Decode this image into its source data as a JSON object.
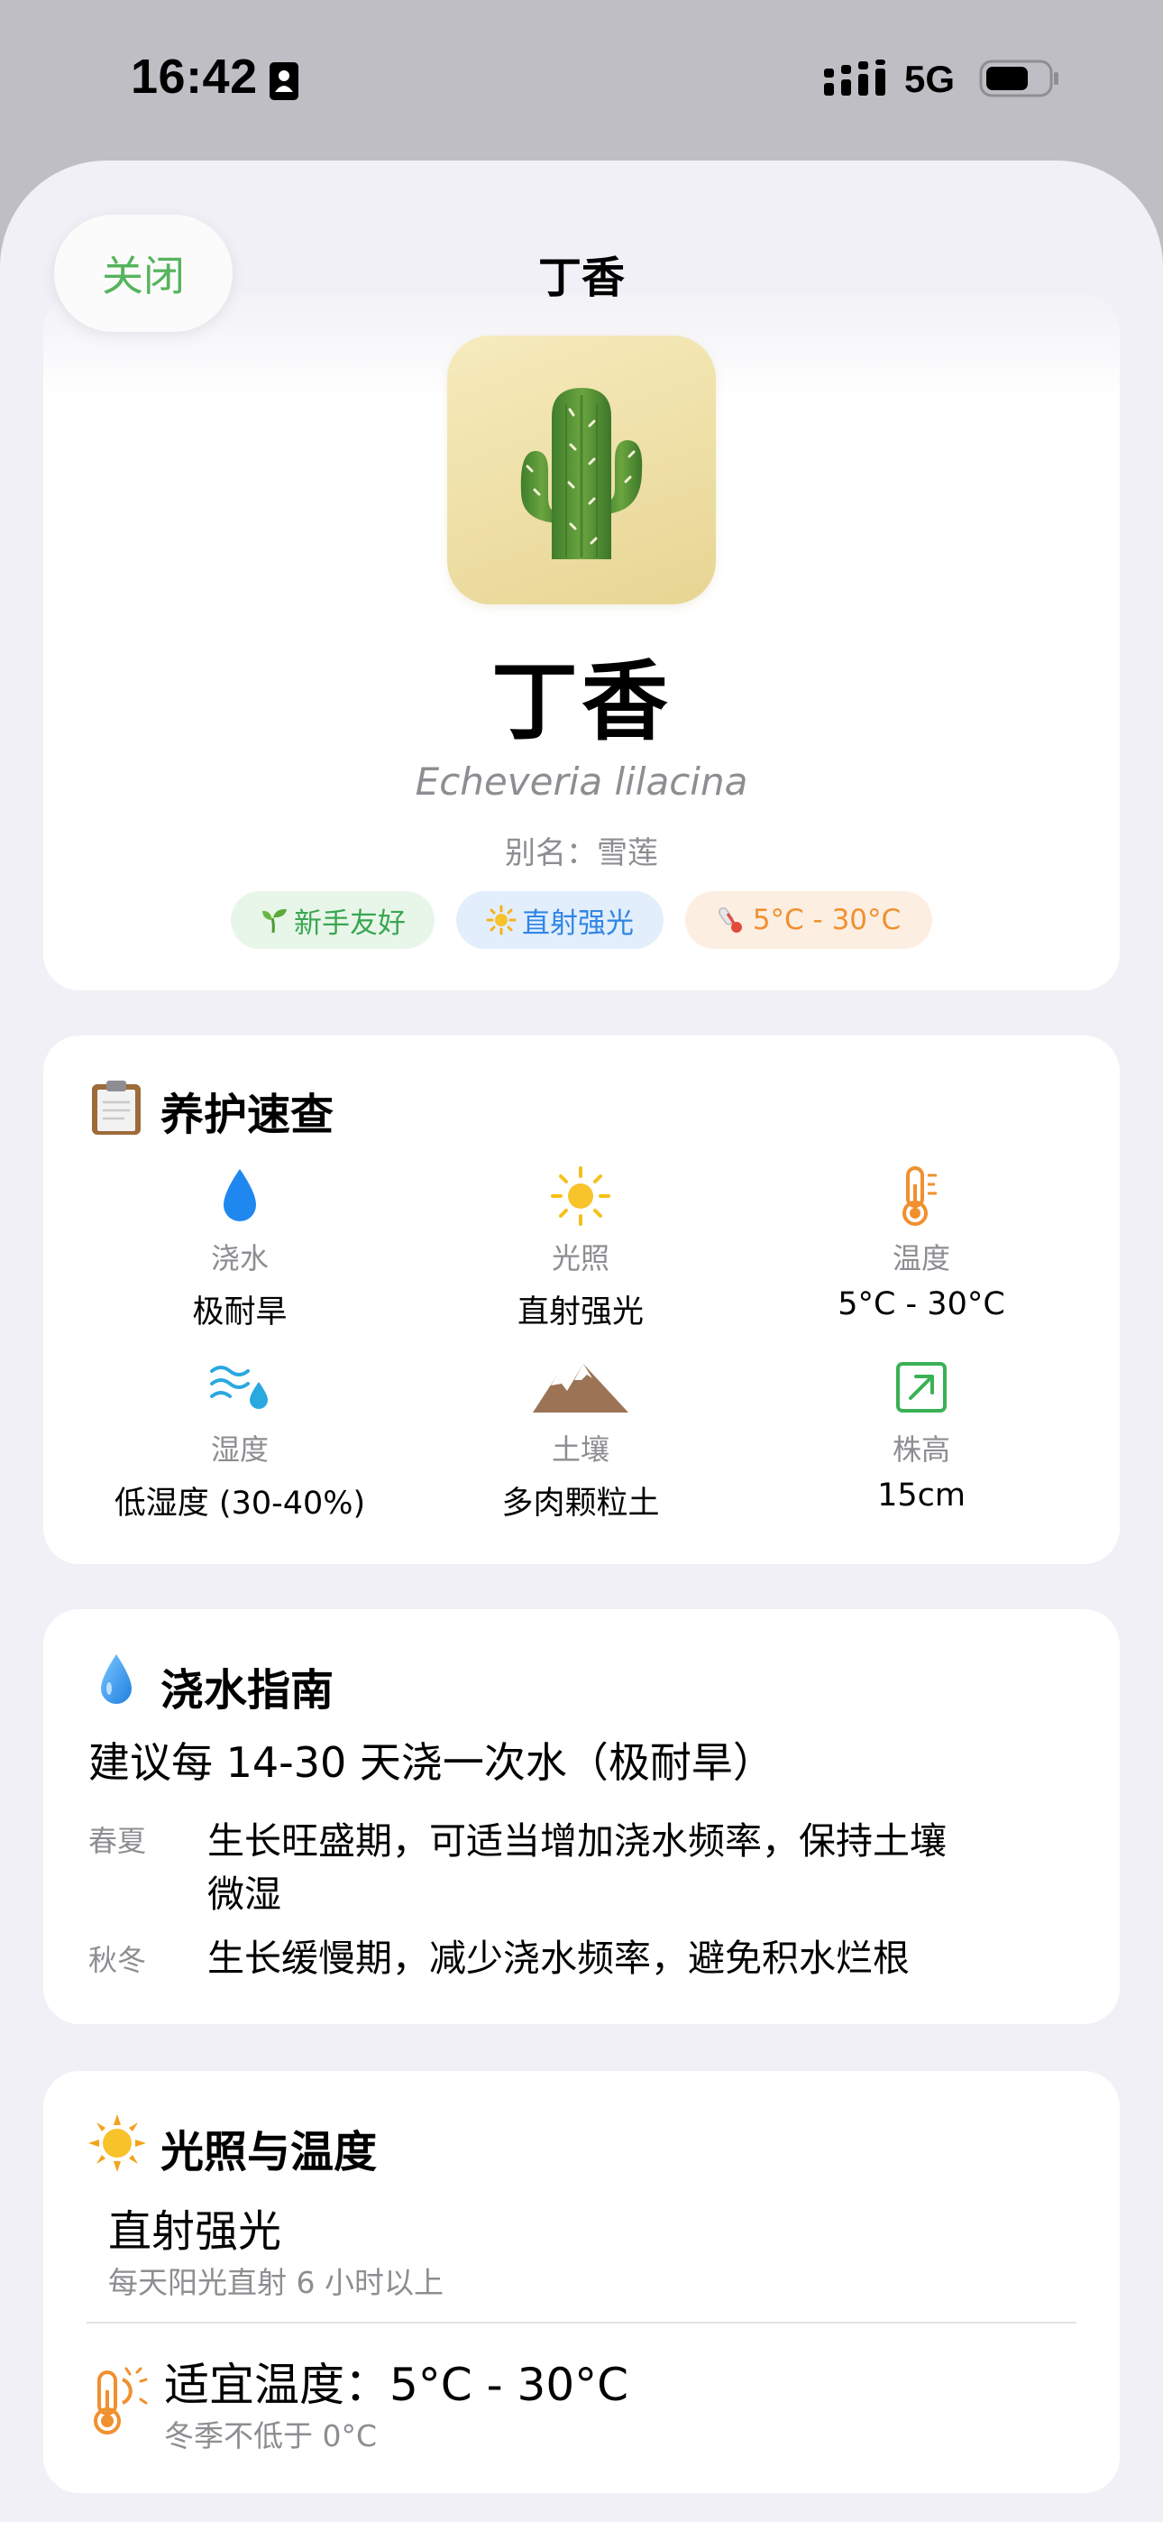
{
  "status_bar": {
    "time": "16:42",
    "network": "5G"
  },
  "header": {
    "close_label": "关闭",
    "title": "丁香"
  },
  "plant": {
    "icon": "cactus-icon",
    "name": "丁香",
    "latin_name": "Echeveria lilacina",
    "alias_text": "别名：雪莲",
    "tags": [
      {
        "icon": "seedling-icon",
        "label": "新手友好",
        "color": "#3aa650"
      },
      {
        "icon": "sun-icon",
        "label": "直射强光",
        "color": "#2f86e6"
      },
      {
        "icon": "thermometer-icon",
        "label": "5°C - 30°C",
        "color": "#f0902f"
      }
    ]
  },
  "care_quick": {
    "title": "养护速查",
    "icon": "clipboard-icon",
    "items": [
      {
        "icon": "water-drop-icon",
        "label": "浇水",
        "value": "极耐旱"
      },
      {
        "icon": "sun-icon",
        "label": "光照",
        "value": "直射强光"
      },
      {
        "icon": "thermometer-icon",
        "label": "温度",
        "value": "5°C - 30°C"
      },
      {
        "icon": "humidity-icon",
        "label": "湿度",
        "value": "低湿度 (30-40%)"
      },
      {
        "icon": "mountain-icon",
        "label": "土壤",
        "value": "多肉颗粒土"
      },
      {
        "icon": "height-arrow-icon",
        "label": "株高",
        "value": "15cm"
      }
    ]
  },
  "watering": {
    "title": "浇水指南",
    "icon": "water-drop-icon",
    "summary": "建议每 14-30 天浇一次水（极耐旱）",
    "seasons": [
      {
        "label": "春夏",
        "text": "生长旺盛期，可适当增加浇水频率，保持土壤微湿"
      },
      {
        "label": "秋冬",
        "text": "生长缓慢期，减少浇水频率，避免积水烂根"
      }
    ]
  },
  "light_temp": {
    "title": "光照与温度",
    "icon": "sun-icon",
    "light_level": "直射强光",
    "light_detail": "每天阳光直射 6 小时以上",
    "temp_label": "适宜温度：5°C - 30°C",
    "temp_note": "冬季不低于 0°C",
    "temp_icon": "thermometer-sun-icon"
  },
  "colors": {
    "accent_green": "#55b45c",
    "sheet_bg": "#f1f0f6",
    "secondary_text": "#8d8d92"
  }
}
